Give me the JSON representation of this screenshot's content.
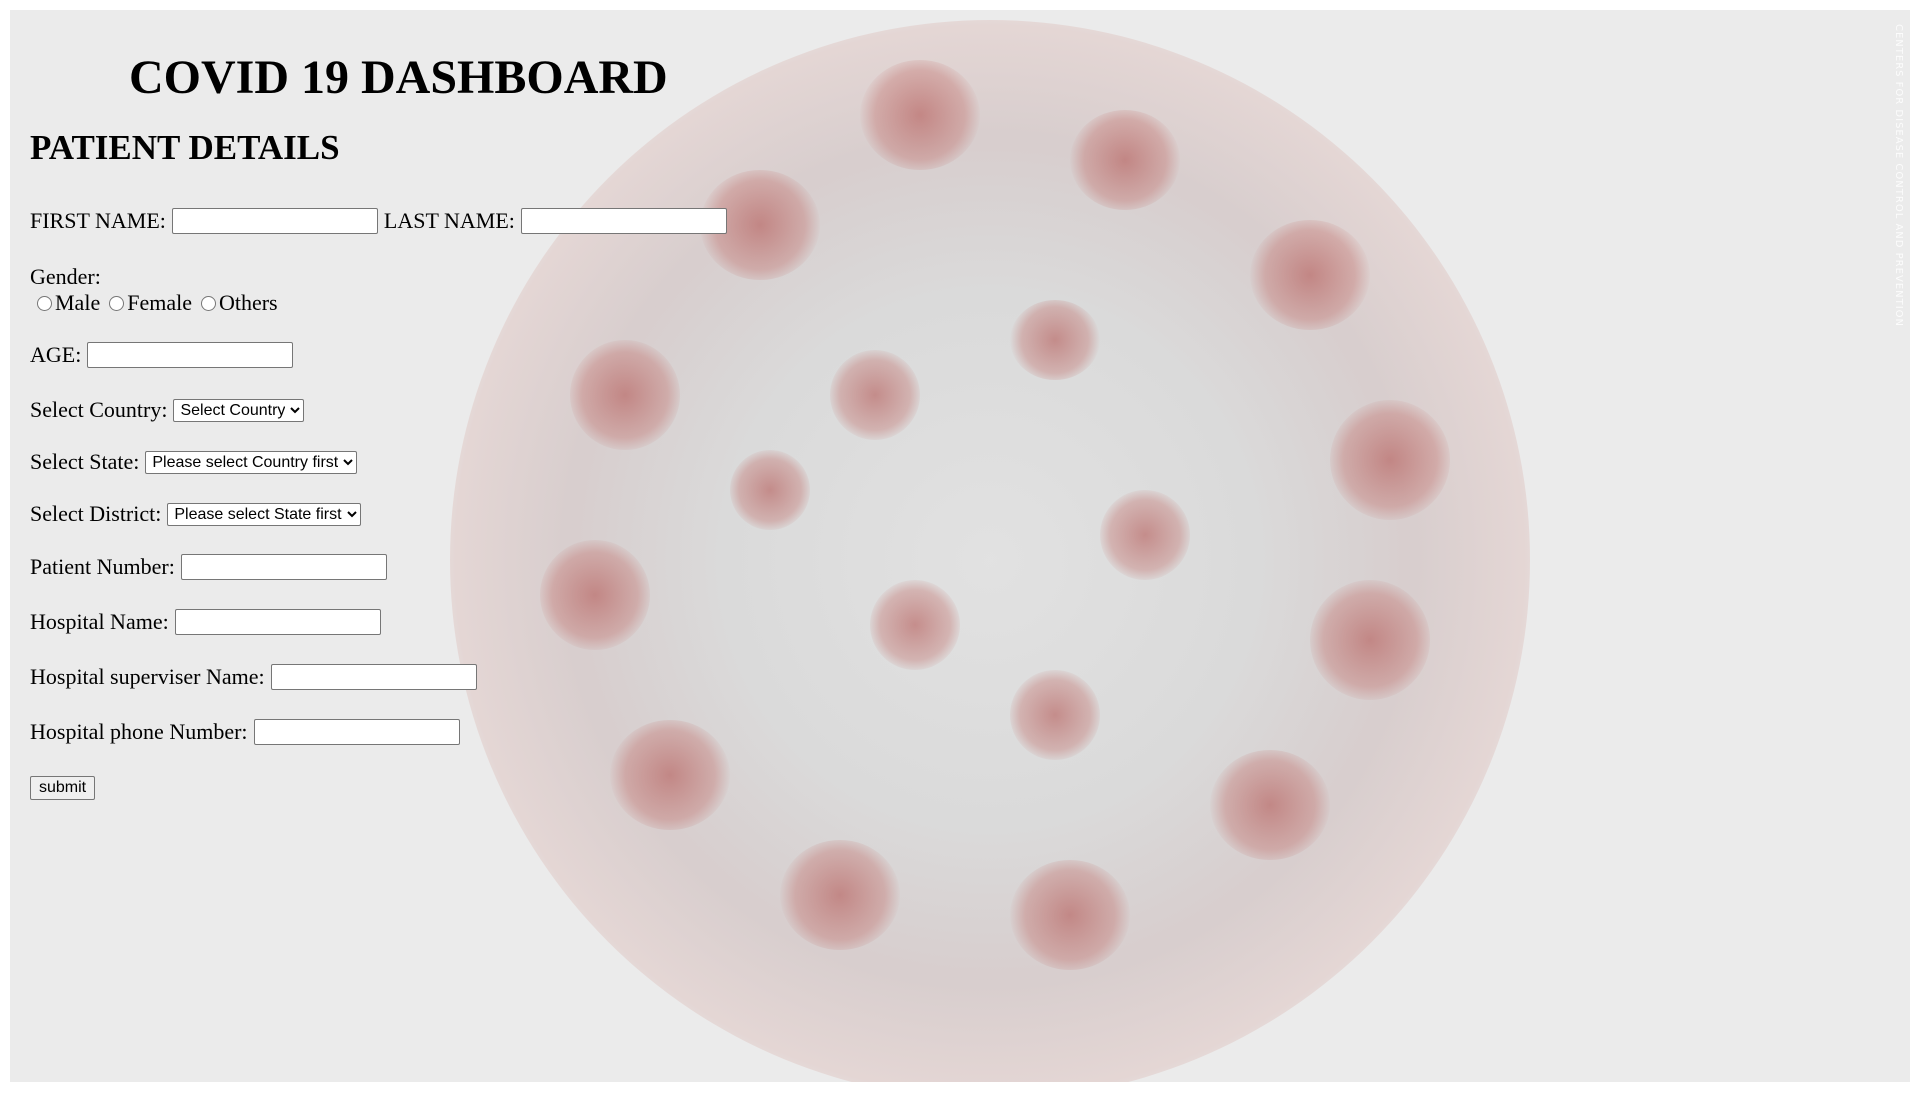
{
  "header": {
    "title": "COVID 19 DASHBOARD",
    "section_title": "PATIENT DETAILS"
  },
  "form": {
    "first_name_label": "FIRST NAME:",
    "first_name_value": "",
    "last_name_label": "LAST NAME:",
    "last_name_value": "",
    "gender_label": "Gender:",
    "gender_options": [
      "Male",
      "Female",
      "Others"
    ],
    "age_label": "AGE:",
    "age_value": "",
    "country_label": "Select Country:",
    "country_selected": "Select Country",
    "state_label": "Select State:",
    "state_selected": "Please select Country first",
    "district_label": "Select District:",
    "district_selected": "Please select State first",
    "patient_number_label": "Patient Number:",
    "patient_number_value": "",
    "hospital_name_label": "Hospital Name:",
    "hospital_name_value": "",
    "supervisor_label": "Hospital superviser Name:",
    "supervisor_value": "",
    "phone_label": "Hospital phone Number:",
    "phone_value": "",
    "submit_label": "submit"
  },
  "background": {
    "credit_text": "CENTERS FOR DISEASE CONTROL AND PREVENTION"
  }
}
